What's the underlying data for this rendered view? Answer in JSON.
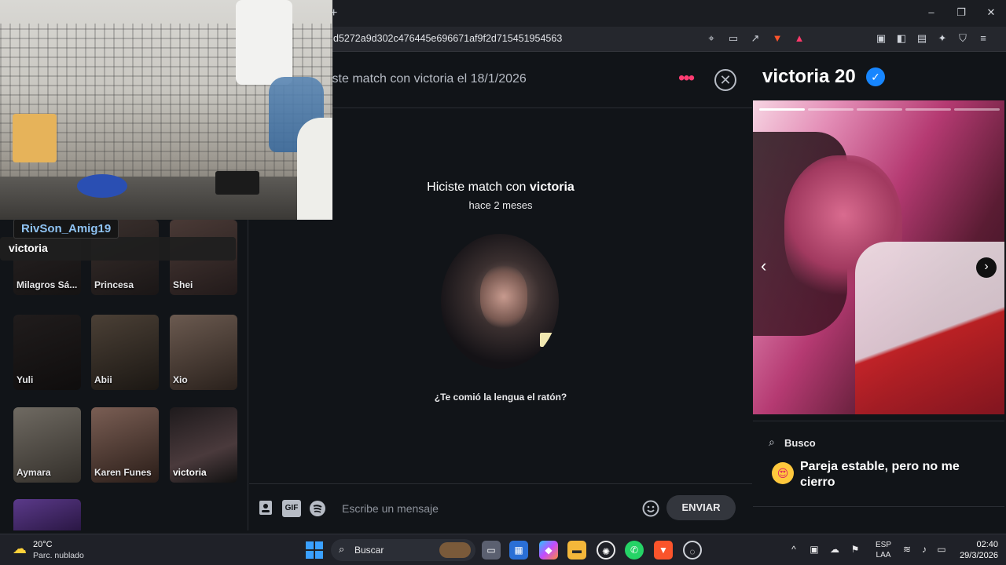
{
  "browser": {
    "new_tab": "+",
    "url": "d5272a9d302c476445e696671af9f2d715451954563",
    "window_controls": {
      "minimize": "–",
      "maximize": "❐",
      "close": "✕"
    },
    "brave_badge": "🦁",
    "rewards_count": "1",
    "icons": [
      "location-icon",
      "cast-icon",
      "share-icon",
      "brave-shields-icon",
      "rewards-icon",
      "reader-icon",
      "sidebar-icon",
      "wallet-icon",
      "leo-icon",
      "vpn-icon",
      "menu-icon"
    ]
  },
  "webcam_overlay": {
    "streamer_name": "RivSon_Amig19",
    "current_chat": "victoria"
  },
  "sidebar": {
    "matches": [
      {
        "name": "Milagros Sá..."
      },
      {
        "name": "Princesa"
      },
      {
        "name": "Shei"
      },
      {
        "name": "Yuli"
      },
      {
        "name": "Abii"
      },
      {
        "name": "Xio"
      },
      {
        "name": "Aymara"
      },
      {
        "name": "Karen Funes"
      },
      {
        "name": "victoria"
      }
    ]
  },
  "chat": {
    "header_title": "iste match con victoria el 18/1/2026",
    "more_dots": "•••",
    "close_symbol": "✕",
    "match_headline_prefix": "Hiciste match con ",
    "match_headline_name": "victoria",
    "match_time": "hace 2 meses",
    "prompt": "¿Te comió la lengua el ratón?",
    "composer": {
      "placeholder": "Escribe un mensaje",
      "gif_label": "GIF",
      "send_label": "ENVIAR"
    }
  },
  "profile": {
    "name_age": "victoria 20",
    "verified_symbol": "✓",
    "photo_count": 5,
    "active_photo_index": 0,
    "prev_symbol": "‹",
    "next_symbol": "›",
    "looking_for_label": "Busco",
    "looking_for_emoji": "😍",
    "looking_for_value": "Pareja estable, pero no me cierro"
  },
  "taskbar": {
    "weather_temp": "20°C",
    "weather_desc": "Parc. nublado",
    "search_label": "Buscar",
    "lang_line1": "ESP",
    "lang_line2": "LAA",
    "time": "02:40",
    "date": "29/3/2026"
  },
  "colors": {
    "accent": "#fe3c72",
    "verified": "#1786ff",
    "background": "#111418",
    "streamer_name": "#8ec2f2"
  }
}
